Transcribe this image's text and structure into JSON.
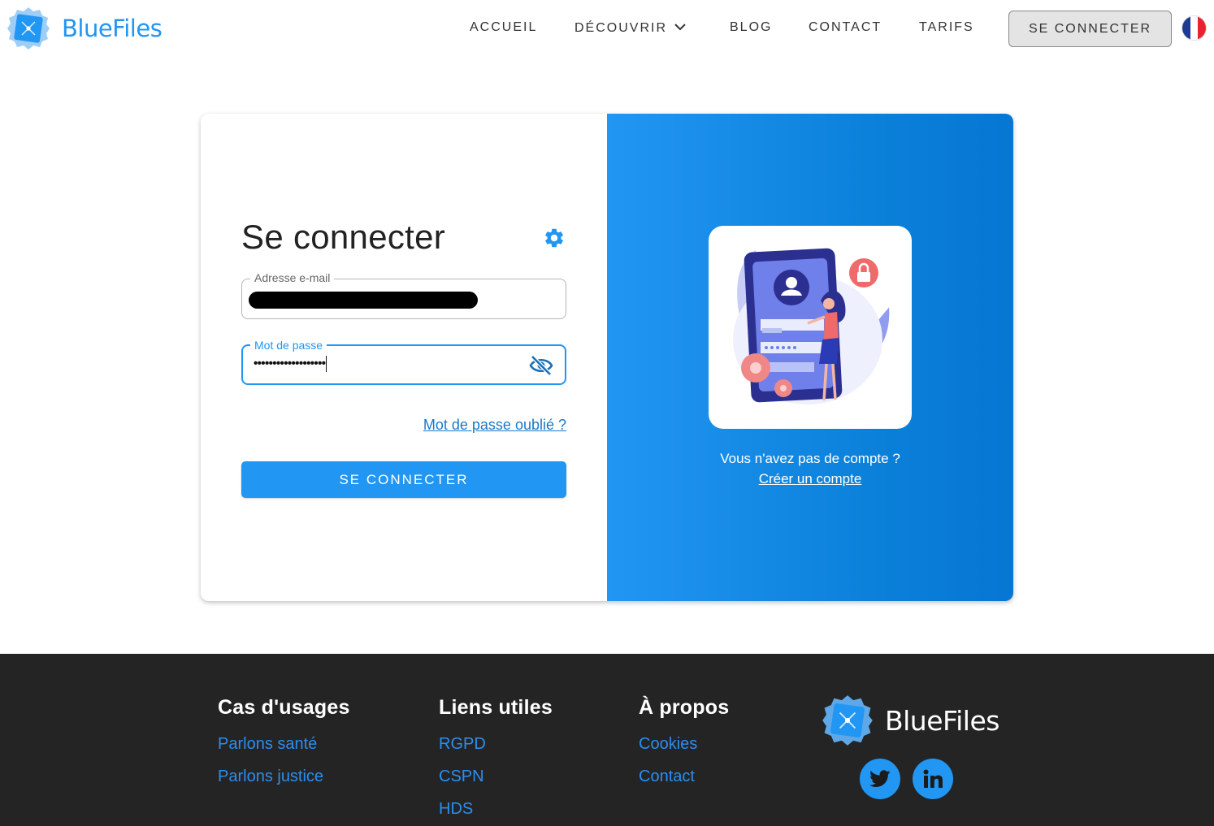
{
  "header": {
    "brand": "BlueFiles",
    "nav": [
      {
        "label": "ACCUEIL"
      },
      {
        "label": "DÉCOUVRIR"
      },
      {
        "label": "BLOG"
      },
      {
        "label": "CONTACT"
      },
      {
        "label": "TARIFS"
      }
    ],
    "login_button": "SE CONNECTER",
    "language_icon": "france-flag-icon"
  },
  "login": {
    "title": "Se connecter",
    "settings_icon": "gear-icon",
    "email_label": "Adresse e-mail",
    "password_label": "Mot de passe",
    "password_value": "•••••••••••••••••••",
    "toggle_icon": "eye-off-icon",
    "forgot_link": "Mot de passe oublié ?",
    "submit_label": "SE CONNECTER"
  },
  "signup": {
    "prompt": "Vous n'avez pas de compte ?",
    "link": "Créer un compte"
  },
  "footer": {
    "columns": [
      {
        "title": "Cas d'usages",
        "links": [
          "Parlons santé",
          "Parlons justice"
        ]
      },
      {
        "title": "Liens utiles",
        "links": [
          "RGPD",
          "CSPN",
          "HDS"
        ]
      },
      {
        "title": "À propos",
        "links": [
          "Cookies",
          "Contact"
        ]
      }
    ],
    "brand": "BlueFiles",
    "social": [
      "twitter-icon",
      "linkedin-icon"
    ]
  },
  "colors": {
    "accent": "#2196f3",
    "footer_bg": "#242424",
    "link": "#1a79c8"
  }
}
